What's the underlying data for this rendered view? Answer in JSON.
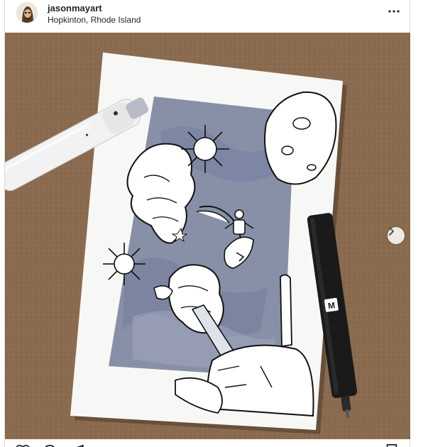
{
  "post": {
    "username": "jasonmayart",
    "location": "Hopkinton, Rhode Island",
    "more_icon": "more-horizontal-icon",
    "next_icon": "chevron-right-icon"
  },
  "colors": {
    "text": "#262626",
    "border": "#dbdbdb",
    "cardboard": "#8a6a4e",
    "wash": "#8890a8"
  }
}
